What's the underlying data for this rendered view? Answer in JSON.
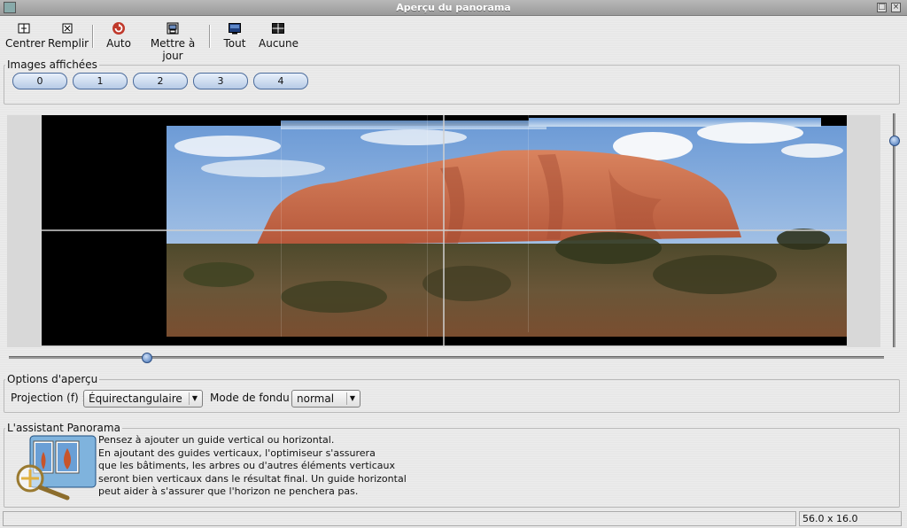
{
  "window": {
    "title": "Aperçu du panorama"
  },
  "toolbar": {
    "center_label": "Centrer",
    "fill_label": "Remplir",
    "auto_label": "Auto",
    "update_label": "Mettre à jour",
    "all_label": "Tout",
    "none_label": "Aucune"
  },
  "images_group": {
    "label": "Images affichées",
    "buttons": [
      "0",
      "1",
      "2",
      "3",
      "4"
    ]
  },
  "options_group": {
    "label": "Options d'aperçu",
    "projection_label": "Projection (f) :",
    "projection_value": "Équirectangulaire",
    "blend_label": "Mode de fondu :",
    "blend_value": "normal"
  },
  "assistant_group": {
    "label": "L'assistant Panorama",
    "lines": [
      "Pensez à ajouter un guide vertical ou horizontal.",
      "En ajoutant des guides verticaux, l'optimiseur s'assurera",
      "que les bâtiments, les arbres ou d'autres éléments verticaux",
      "seront bien verticaux dans le résultat final. Un guide horizontal",
      "peut aider à s'assurer que l'horizon ne penchera pas."
    ]
  },
  "status": {
    "fov": "56.0 x 16.0"
  },
  "colors": {
    "accent": "#3f6fb4",
    "sky": "#9fc0e6",
    "rock": "#c9694a",
    "ground": "#5b4a32"
  }
}
